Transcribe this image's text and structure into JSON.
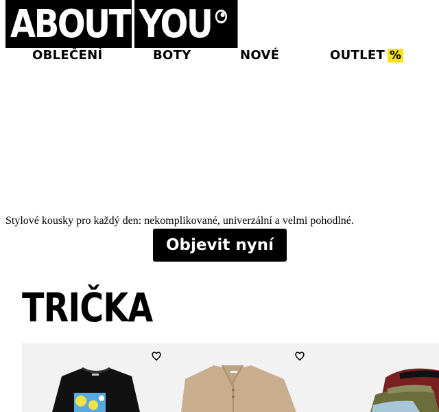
{
  "logo": {
    "word1": "ABOUT",
    "word2": "YOU"
  },
  "nav": {
    "clothes": "OBLEČENÍ",
    "shoes": "BOTY",
    "new": "NOVÉ",
    "outlet": "OUTLET",
    "outlet_badge": "%"
  },
  "hero": {
    "text": "Stylové kousky pro každý den: nekomplikované, univerzální a velmi pohodlné.",
    "cta": "Objevit nyní"
  },
  "section": {
    "title": "TRIČKA"
  },
  "colors": {
    "accent_yellow": "#f7e21a",
    "brand": "#000000",
    "tile_bg": "#f2f2f2"
  },
  "products": [
    {
      "image": "black-graphic-tshirt",
      "wishlist_icon": "heart-icon"
    },
    {
      "image": "beige-polo-shirt",
      "wishlist_icon": "heart-icon"
    },
    {
      "image": "stacked-tshirts"
    }
  ]
}
